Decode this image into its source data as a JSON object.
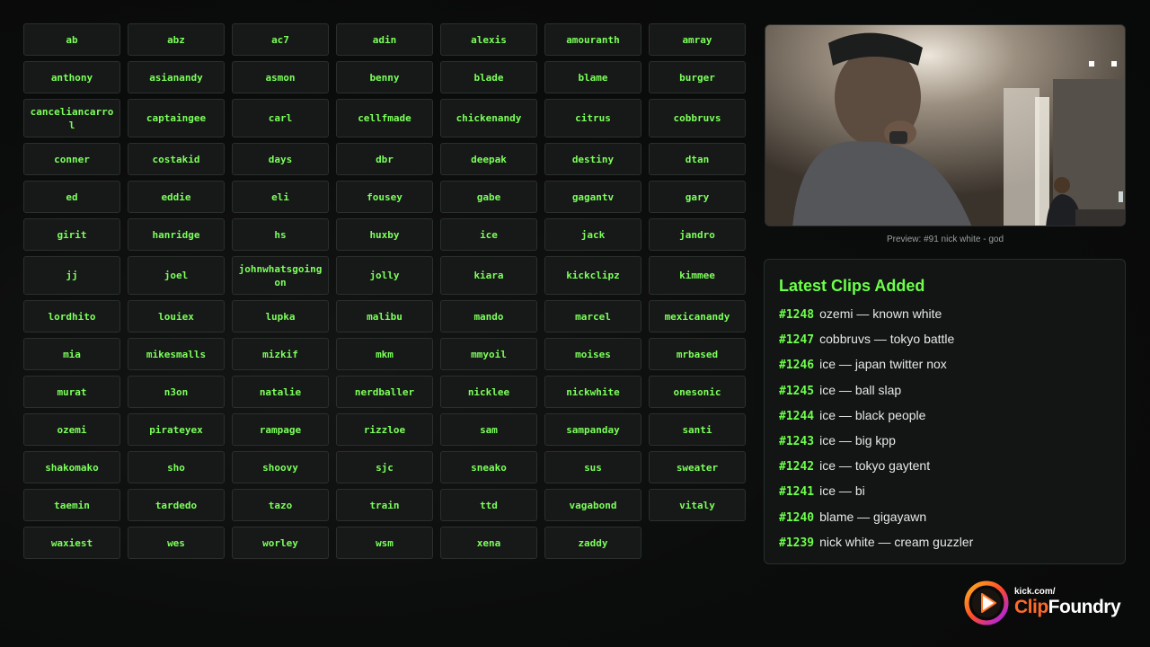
{
  "clips": [
    "ab",
    "abz",
    "ac7",
    "adin",
    "alexis",
    "amouranth",
    "amray",
    "anthony",
    "asianandy",
    "asmon",
    "benny",
    "blade",
    "blame",
    "burger",
    "canceliancarrol",
    "captaingee",
    "carl",
    "cellfmade",
    "chickenandy",
    "citrus",
    "cobbruvs",
    "conner",
    "costakid",
    "days",
    "dbr",
    "deepak",
    "destiny",
    "dtan",
    "ed",
    "eddie",
    "eli",
    "fousey",
    "gabe",
    "gagantv",
    "gary",
    "girit",
    "hanridge",
    "hs",
    "huxby",
    "ice",
    "jack",
    "jandro",
    "jj",
    "joel",
    "johnwhatsgoingon",
    "jolly",
    "kiara",
    "kickclipz",
    "kimmee",
    "lordhito",
    "louiex",
    "lupka",
    "malibu",
    "mando",
    "marcel",
    "mexicanandy",
    "mia",
    "mikesmalls",
    "mizkif",
    "mkm",
    "mmyoil",
    "moises",
    "mrbased",
    "murat",
    "n3on",
    "natalie",
    "nerdballer",
    "nicklee",
    "nickwhite",
    "onesonic",
    "ozemi",
    "pirateyex",
    "rampage",
    "rizzloe",
    "sam",
    "sampanday",
    "santi",
    "shakomako",
    "sho",
    "shoovy",
    "sjc",
    "sneako",
    "sus",
    "sweater",
    "taemin",
    "tardedo",
    "tazo",
    "train",
    "ttd",
    "vagabond",
    "vitaly",
    "waxiest",
    "wes",
    "worley",
    "wsm",
    "xena",
    "zaddy"
  ],
  "preview": {
    "caption": "Preview: #91 nick white - god"
  },
  "latest": {
    "title": "Latest Clips Added",
    "items": [
      {
        "id": "#1248",
        "text": "ozemi — known white"
      },
      {
        "id": "#1247",
        "text": "cobbruvs — tokyo battle"
      },
      {
        "id": "#1246",
        "text": "ice — japan twitter nox"
      },
      {
        "id": "#1245",
        "text": "ice — ball slap"
      },
      {
        "id": "#1244",
        "text": "ice — black people"
      },
      {
        "id": "#1243",
        "text": "ice — big kpp"
      },
      {
        "id": "#1242",
        "text": "ice — tokyo gaytent"
      },
      {
        "id": "#1241",
        "text": "ice — bi"
      },
      {
        "id": "#1240",
        "text": "blame — gigayawn"
      },
      {
        "id": "#1239",
        "text": "nick white — cream guzzler"
      }
    ]
  },
  "logo": {
    "small": "kick.com/",
    "clip": "Clip",
    "foundry": "Foundry"
  },
  "colors": {
    "accent": "#6dff4a",
    "button_text": "#7cff5a",
    "background": "#0a0b0b"
  }
}
